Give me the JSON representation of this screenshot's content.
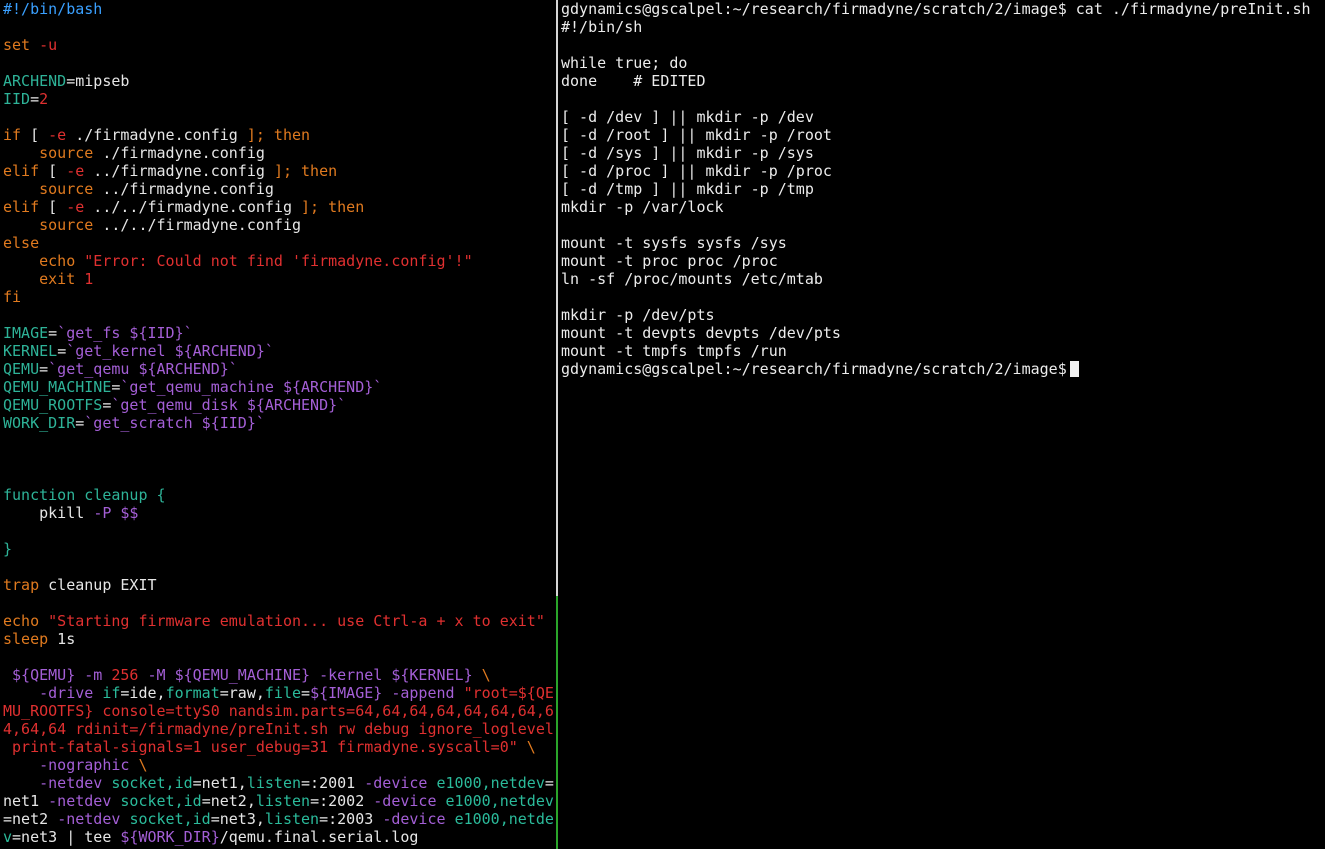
{
  "colors": {
    "comment": "#3aa0ff",
    "keyword": "#e07a1f",
    "identifier": "#2eb398",
    "string": "#e03030",
    "command": "#a45fd6",
    "plain": "#e6e6e6",
    "divider": "#d6d6d6",
    "divider_active": "#2aa52a"
  },
  "editor": {
    "lines": [
      [
        [
          "comment",
          "#!/bin/bash"
        ]
      ],
      [],
      [
        [
          "kw",
          "set"
        ],
        [
          "str",
          " -u"
        ]
      ],
      [],
      [
        [
          "ident",
          "ARCHEND"
        ],
        [
          "plain",
          "=mipseb"
        ]
      ],
      [
        [
          "ident",
          "IID"
        ],
        [
          "plain",
          "="
        ],
        [
          "str",
          "2"
        ]
      ],
      [],
      [
        [
          "kw",
          "if"
        ],
        [
          "plain",
          " [ "
        ],
        [
          "str",
          "-e"
        ],
        [
          "plain",
          " ./firmadyne.config "
        ],
        [
          "kw",
          "]; then"
        ]
      ],
      [
        [
          "plain",
          "    "
        ],
        [
          "kw",
          "source"
        ],
        [
          "plain",
          " ./firmadyne.config"
        ]
      ],
      [
        [
          "kw",
          "elif"
        ],
        [
          "plain",
          " [ "
        ],
        [
          "str",
          "-e"
        ],
        [
          "plain",
          " ../firmadyne.config "
        ],
        [
          "kw",
          "]; then"
        ]
      ],
      [
        [
          "plain",
          "    "
        ],
        [
          "kw",
          "source"
        ],
        [
          "plain",
          " ../firmadyne.config"
        ]
      ],
      [
        [
          "kw",
          "elif"
        ],
        [
          "plain",
          " [ "
        ],
        [
          "str",
          "-e"
        ],
        [
          "plain",
          " ../../firmadyne.config "
        ],
        [
          "kw",
          "]; then"
        ]
      ],
      [
        [
          "plain",
          "    "
        ],
        [
          "kw",
          "source"
        ],
        [
          "plain",
          " ../../firmadyne.config"
        ]
      ],
      [
        [
          "kw",
          "else"
        ]
      ],
      [
        [
          "plain",
          "    "
        ],
        [
          "kw",
          "echo"
        ],
        [
          "plain",
          " "
        ],
        [
          "str",
          "\"Error: Could not find 'firmadyne.config'!\""
        ]
      ],
      [
        [
          "plain",
          "    "
        ],
        [
          "kw",
          "exit"
        ],
        [
          "plain",
          " "
        ],
        [
          "str",
          "1"
        ]
      ],
      [
        [
          "kw",
          "fi"
        ]
      ],
      [],
      [
        [
          "ident",
          "IMAGE"
        ],
        [
          "plain",
          "="
        ],
        [
          "cmd",
          "`get_fs ${IID}`"
        ]
      ],
      [
        [
          "ident",
          "KERNEL"
        ],
        [
          "plain",
          "="
        ],
        [
          "cmd",
          "`get_kernel ${ARCHEND}`"
        ]
      ],
      [
        [
          "ident",
          "QEMU"
        ],
        [
          "plain",
          "="
        ],
        [
          "cmd",
          "`get_qemu ${ARCHEND}`"
        ]
      ],
      [
        [
          "ident",
          "QEMU_MACHINE"
        ],
        [
          "plain",
          "="
        ],
        [
          "cmd",
          "`get_qemu_machine ${ARCHEND}`"
        ]
      ],
      [
        [
          "ident",
          "QEMU_ROOTFS"
        ],
        [
          "plain",
          "="
        ],
        [
          "cmd",
          "`get_qemu_disk ${ARCHEND}`"
        ]
      ],
      [
        [
          "ident",
          "WORK_DIR"
        ],
        [
          "plain",
          "="
        ],
        [
          "cmd",
          "`get_scratch ${IID}`"
        ]
      ],
      [],
      [],
      [],
      [
        [
          "ident",
          "function cleanup {"
        ]
      ],
      [
        [
          "plain",
          "    pkill "
        ],
        [
          "cmd",
          "-P $$"
        ]
      ],
      [],
      [
        [
          "ident",
          "}"
        ]
      ],
      [],
      [
        [
          "kw",
          "trap"
        ],
        [
          "plain",
          " cleanup EXIT"
        ]
      ],
      [],
      [
        [
          "kw",
          "echo"
        ],
        [
          "plain",
          " "
        ],
        [
          "str",
          "\"Starting firmware emulation... use Ctrl-a + x to exit\""
        ]
      ],
      [
        [
          "kw",
          "sleep"
        ],
        [
          "plain",
          " 1s"
        ]
      ],
      [],
      [
        [
          "plain",
          " "
        ],
        [
          "cmd",
          "${QEMU}"
        ],
        [
          "plain",
          " "
        ],
        [
          "cmd",
          "-m"
        ],
        [
          "plain",
          " "
        ],
        [
          "str",
          "256"
        ],
        [
          "plain",
          " "
        ],
        [
          "cmd",
          "-M ${QEMU_MACHINE} -kernel ${KERNEL}"
        ],
        [
          "plain",
          " "
        ],
        [
          "kw",
          "\\"
        ]
      ],
      [
        [
          "plain",
          "    "
        ],
        [
          "cmd",
          "-drive"
        ],
        [
          "plain",
          " "
        ],
        [
          "green",
          "if"
        ],
        [
          "plain",
          "=ide,"
        ],
        [
          "green",
          "format"
        ],
        [
          "plain",
          "=raw,"
        ],
        [
          "green",
          "file"
        ],
        [
          "plain",
          "="
        ],
        [
          "cmd",
          "${IMAGE} -append"
        ],
        [
          "plain",
          " "
        ],
        [
          "str",
          "\"root=${QE"
        ]
      ],
      [
        [
          "str",
          "MU_ROOTFS} console=ttyS0 nandsim.parts=64,64,64,64,64,64,64,6"
        ]
      ],
      [
        [
          "str",
          "4,64,64 rdinit=/firmadyne/preInit.sh rw debug ignore_loglevel"
        ]
      ],
      [
        [
          "str",
          " print-fatal-signals=1 user_debug=31 firmadyne.syscall=0\""
        ],
        [
          "plain",
          " "
        ],
        [
          "kw",
          "\\"
        ]
      ],
      [
        [
          "plain",
          "    "
        ],
        [
          "cmd",
          "-nographic"
        ],
        [
          "plain",
          " "
        ],
        [
          "kw",
          "\\"
        ]
      ],
      [
        [
          "plain",
          "    "
        ],
        [
          "cmd",
          "-netdev"
        ],
        [
          "plain",
          " "
        ],
        [
          "green",
          "socket,id"
        ],
        [
          "plain",
          "=net1,"
        ],
        [
          "green",
          "listen"
        ],
        [
          "plain",
          "=:2001 "
        ],
        [
          "cmd",
          "-device"
        ],
        [
          "plain",
          " "
        ],
        [
          "green",
          "e1000,netdev"
        ],
        [
          "plain",
          "="
        ]
      ],
      [
        [
          "plain",
          "net1 "
        ],
        [
          "cmd",
          "-netdev"
        ],
        [
          "plain",
          " "
        ],
        [
          "green",
          "socket,id"
        ],
        [
          "plain",
          "=net2,"
        ],
        [
          "green",
          "listen"
        ],
        [
          "plain",
          "=:2002 "
        ],
        [
          "cmd",
          "-device"
        ],
        [
          "plain",
          " "
        ],
        [
          "green",
          "e1000,netdev"
        ]
      ],
      [
        [
          "plain",
          "=net2 "
        ],
        [
          "cmd",
          "-netdev"
        ],
        [
          "plain",
          " "
        ],
        [
          "green",
          "socket,id"
        ],
        [
          "plain",
          "=net3,"
        ],
        [
          "green",
          "listen"
        ],
        [
          "plain",
          "=:2003 "
        ],
        [
          "cmd",
          "-device"
        ],
        [
          "plain",
          " "
        ],
        [
          "green",
          "e1000,netde"
        ]
      ],
      [
        [
          "green",
          "v"
        ],
        [
          "plain",
          "=net3 | tee "
        ],
        [
          "cmd",
          "${WORK_DIR}"
        ],
        [
          "plain",
          "/qemu.final.serial.log"
        ]
      ]
    ]
  },
  "terminal": {
    "lines": [
      "gdynamics@gscalpel:~/research/firmadyne/scratch/2/image$ cat ./firmadyne/preInit.sh",
      "#!/bin/sh",
      "",
      "while true; do",
      "done    # EDITED",
      "",
      "[ -d /dev ] || mkdir -p /dev",
      "[ -d /root ] || mkdir -p /root",
      "[ -d /sys ] || mkdir -p /sys",
      "[ -d /proc ] || mkdir -p /proc",
      "[ -d /tmp ] || mkdir -p /tmp",
      "mkdir -p /var/lock",
      "",
      "mount -t sysfs sysfs /sys",
      "mount -t proc proc /proc",
      "ln -sf /proc/mounts /etc/mtab",
      "",
      "mkdir -p /dev/pts",
      "mount -t devpts devpts /dev/pts",
      "mount -t tmpfs tmpfs /run"
    ],
    "prompt": "gdynamics@gscalpel:~/research/firmadyne/scratch/2/image$"
  }
}
